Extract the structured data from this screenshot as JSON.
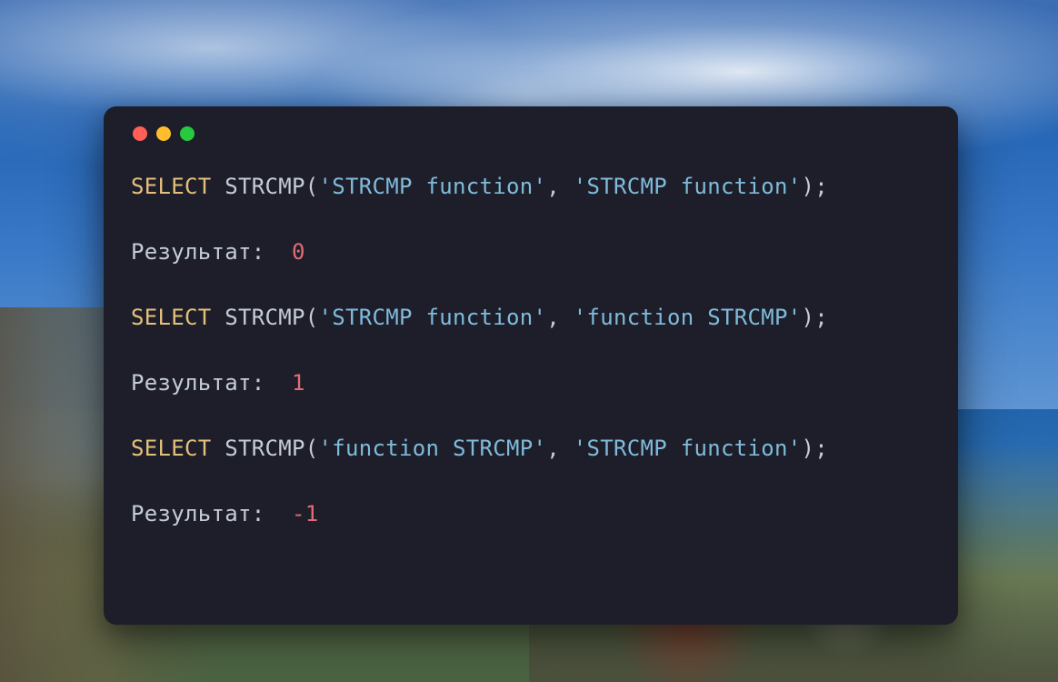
{
  "window": {
    "type": "terminal-code-window"
  },
  "colors": {
    "close": "#ff5f56",
    "minimize": "#ffbd2e",
    "maximize": "#27c93f",
    "bg": "#1e1e2a",
    "keyword": "#e5c07b",
    "string": "#7fbbdb",
    "number": "#e06c75",
    "text": "#c4cdd5"
  },
  "queries": [
    {
      "select": "SELECT",
      "func": "STRCMP",
      "open": "(",
      "arg1": "'STRCMP function'",
      "comma": ", ",
      "arg2": "'STRCMP function'",
      "close": ");",
      "result_label": "Результат:  ",
      "result_value": "0"
    },
    {
      "select": "SELECT",
      "func": "STRCMP",
      "open": "(",
      "arg1": "'STRCMP function'",
      "comma": ", ",
      "arg2": "'function STRCMP'",
      "close": ");",
      "result_label": "Результат:  ",
      "result_value": "1"
    },
    {
      "select": "SELECT",
      "func": "STRCMP",
      "open": "(",
      "arg1": "'function STRCMP'",
      "comma": ", ",
      "arg2": "'STRCMP function'",
      "close": ");",
      "result_label": "Результат:  ",
      "result_value": "-1"
    }
  ]
}
